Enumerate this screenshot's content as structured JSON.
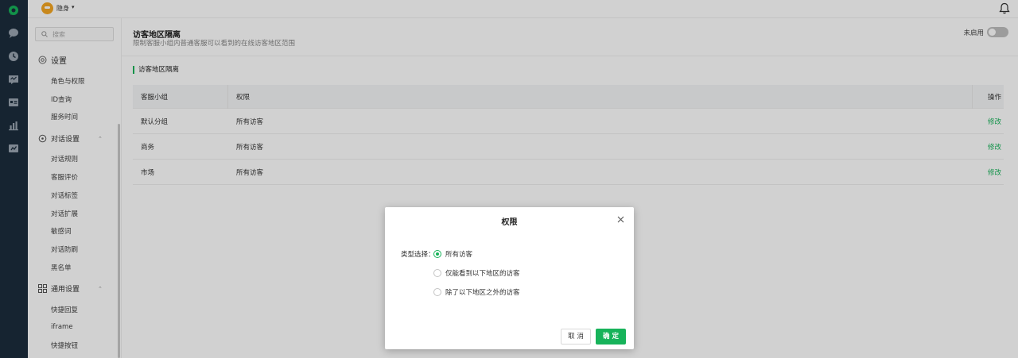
{
  "topbar": {
    "status": "隐身",
    "status_caret": "▾"
  },
  "sidebar": {
    "search_placeholder": "搜索",
    "settings_title": "设置",
    "settings_items": [
      "角色与权限",
      "ID查询",
      "服务时间"
    ],
    "dialog_title": "对话设置",
    "dialog_items": [
      "对话规则",
      "客服评价",
      "对话标签",
      "对话扩展",
      "敏感词",
      "对话防刷",
      "黑名单"
    ],
    "general_title": "通用设置",
    "general_items": [
      "快捷回复",
      "iframe",
      "快捷按钮"
    ],
    "chevron": "⌃"
  },
  "main": {
    "title": "访客地区隔离",
    "subtitle": "限制客服小组内普通客服可以看到的在线访客地区范围",
    "toggle_label": "未启用",
    "section_title": "访客地区隔离",
    "table": {
      "headers": [
        "客服小组",
        "权限",
        "操作"
      ],
      "rows": [
        {
          "group": "默认分组",
          "permission": "所有访客",
          "action": "修改"
        },
        {
          "group": "商务",
          "permission": "所有访客",
          "action": "修改"
        },
        {
          "group": "市场",
          "permission": "所有访客",
          "action": "修改"
        }
      ]
    }
  },
  "modal": {
    "title": "权限",
    "type_label": "类型选择：",
    "options": [
      "所有访客",
      "仅能看到以下地区的访客",
      "除了以下地区之外的访客"
    ],
    "selected_index": 0,
    "cancel": "取 消",
    "confirm": "确 定"
  },
  "colors": {
    "accent": "#17b35a",
    "rail": "#1c2d3c"
  }
}
